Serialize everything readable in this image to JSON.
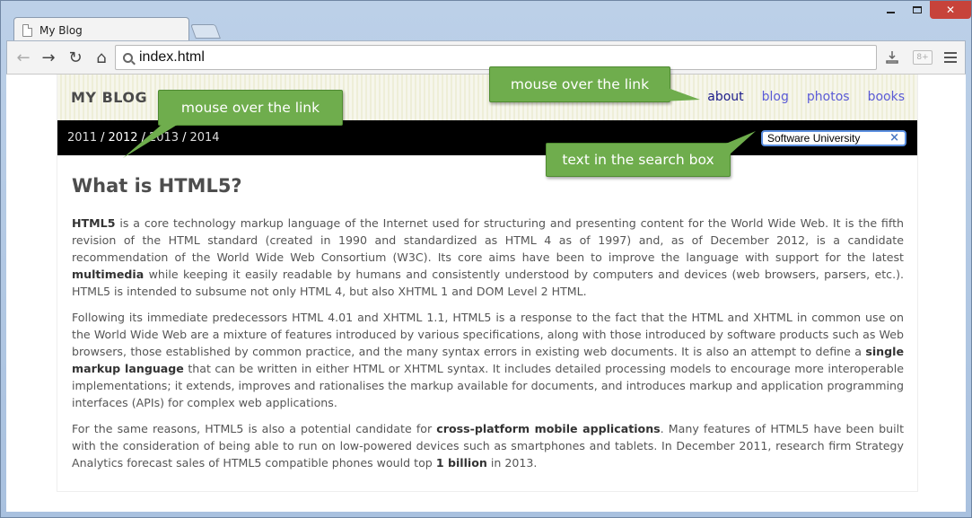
{
  "browser": {
    "tab_title": "My Blog",
    "address": "index.html",
    "ext_badge": "8+"
  },
  "site": {
    "logo": "MY BLOG",
    "nav": [
      {
        "label": "about"
      },
      {
        "label": "blog"
      },
      {
        "label": "photos"
      },
      {
        "label": "books"
      }
    ],
    "years": [
      "2011",
      "2012",
      "2013",
      "2014"
    ],
    "year_separator": "/",
    "search_value": "Software University"
  },
  "article": {
    "title": "What is HTML5?",
    "p1": {
      "b1": "HTML5",
      "t1": " is a core technology markup language of the Internet used for structuring and presenting content for the World Wide Web. It is the fifth revision of the HTML standard (created in 1990 and standardized as HTML 4 as of 1997) and, as of December 2012, is a candidate recommendation of the World Wide Web Consortium (W3C). Its core aims have been to improve the language with support for the latest ",
      "b2": "multimedia",
      "t2": " while keeping it easily readable by humans and consistently understood by computers and devices (web browsers, parsers, etc.). HTML5 is intended to subsume not only HTML 4, but also XHTML 1 and DOM Level 2 HTML."
    },
    "p2": {
      "t1": "Following its immediate predecessors HTML 4.01 and XHTML 1.1, HTML5 is a response to the fact that the HTML and XHTML in common use on the World Wide Web are a mixture of features introduced by various specifications, along with those introduced by software products such as Web browsers, those established by common practice, and the many syntax errors in existing web documents. It is also an attempt to define a ",
      "b1": "single markup language",
      "t2": " that can be written in either HTML or XHTML syntax. It includes detailed processing models to encourage more interoperable implementations; it extends, improves and rationalises the markup available for documents, and introduces markup and application programming interfaces (APIs) for complex web applications."
    },
    "p3": {
      "t1": "For the same reasons, HTML5 is also a potential candidate for ",
      "b1": "cross-platform mobile applications",
      "t2": ". Many features of HTML5 have been built with the consideration of being able to run on low-powered devices such as smartphones and tablets. In December 2011, research firm Strategy Analytics forecast sales of HTML5 compatible phones would top ",
      "b2": "1 billion",
      "t3": " in 2013."
    }
  },
  "callouts": {
    "left": "mouse over the link",
    "right": "mouse over the link",
    "search": "text in the search box"
  },
  "colors": {
    "callout": "#6fad4d",
    "nav_link": "#5b5bd6",
    "nav_hover": "#1c1c8a",
    "year_bar": "#000000"
  }
}
